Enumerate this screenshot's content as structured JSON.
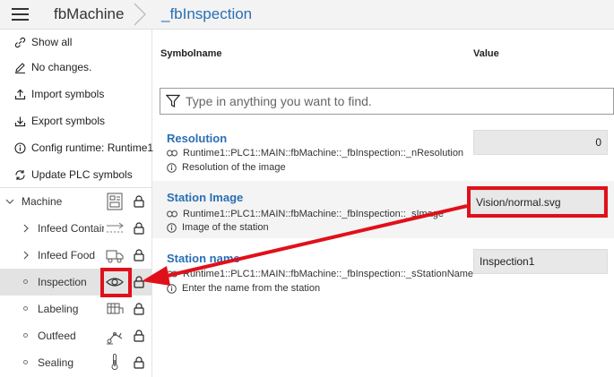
{
  "header": {
    "menu_icon": "hamburger-icon",
    "breadcrumb_root": "fbMachine",
    "breadcrumb_current": "_fbInspection"
  },
  "sidebar": {
    "actions": [
      {
        "label": "Show all",
        "icon": "link-icon"
      },
      {
        "label": "No changes.",
        "icon": "pencil-icon"
      },
      {
        "label": "Import symbols",
        "icon": "upload-icon"
      },
      {
        "label": "Export symbols",
        "icon": "download-icon"
      },
      {
        "label": "Config runtime: Runtime1",
        "icon": "info-icon"
      },
      {
        "label": "Update PLC symbols",
        "icon": "refresh-icon"
      }
    ],
    "tree": [
      {
        "label": "Machine",
        "icon": "machine-icon",
        "expanded": true
      },
      {
        "label": "Infeed Container",
        "icon": "conveyor-icon"
      },
      {
        "label": "Infeed Food",
        "icon": "truck-icon"
      },
      {
        "label": "Inspection",
        "icon": "eye-icon",
        "selected": true
      },
      {
        "label": "Labeling",
        "icon": "labeling-icon"
      },
      {
        "label": "Outfeed",
        "icon": "robot-arm-icon"
      },
      {
        "label": "Sealing",
        "icon": "thermometer-icon"
      }
    ]
  },
  "main": {
    "col_symbolname": "Symbolname",
    "col_value": "Value",
    "search_placeholder": "Type in anything you want to find.",
    "rows": [
      {
        "name": "Resolution",
        "path": "Runtime1::PLC1::MAIN::fbMachine::_fbInspection::_nResolution",
        "description": "Resolution of the image",
        "value": "0"
      },
      {
        "name": "Station Image",
        "path": "Runtime1::PLC1::MAIN::fbMachine::_fbInspection::_sImage",
        "description": "Image of the station",
        "value": "Vision/normal.svg"
      },
      {
        "name": "Station name",
        "path": "Runtime1::PLC1::MAIN::fbMachine::_fbInspection::_sStationName",
        "description": "Enter the name from the station",
        "value": "Inspection1"
      }
    ]
  },
  "colors": {
    "accent": "#2a6fb4",
    "highlight": "#e0101a",
    "selected_row": "#e3e3e3"
  }
}
